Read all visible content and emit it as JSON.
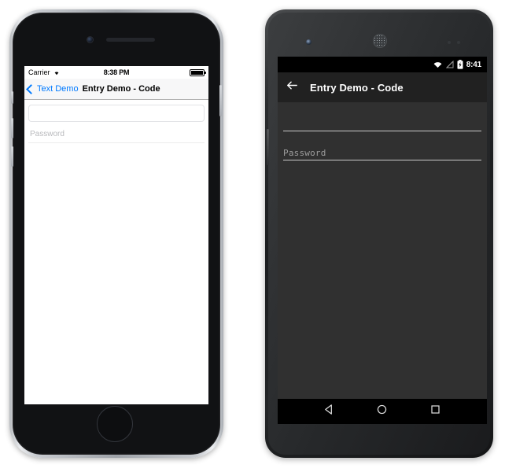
{
  "ios": {
    "device_name": "iphone-device",
    "status_bar": {
      "carrier": "Carrier",
      "wifi_icon": "wifi-icon",
      "time": "8:38 PM",
      "battery_icon": "battery-full-icon"
    },
    "nav_bar": {
      "back_icon": "chevron-left-icon",
      "back_label": "Text Demo",
      "title": "Entry Demo - Code"
    },
    "fields": [
      {
        "name": "entry-field",
        "value": "",
        "placeholder": ""
      },
      {
        "name": "password-field",
        "value": "",
        "placeholder": "Password"
      }
    ],
    "hardware": {
      "camera": "front-camera",
      "speaker": "earpiece-speaker",
      "home_button": "home-button",
      "mute_switch": "mute-switch",
      "volume_up": "volume-up-button",
      "volume_down": "volume-down-button",
      "power": "power-button"
    }
  },
  "android": {
    "device_name": "android-device",
    "status_bar": {
      "wifi_icon": "wifi-icon",
      "signal_icon": "no-signal-icon",
      "battery_icon": "battery-charging-icon",
      "time": "8:41"
    },
    "app_bar": {
      "back_icon": "arrow-left-icon",
      "title": "Entry Demo - Code"
    },
    "fields": [
      {
        "name": "entry-field",
        "value": "",
        "placeholder": ""
      },
      {
        "name": "password-field",
        "value": "",
        "placeholder": "Password"
      }
    ],
    "nav_bar": {
      "back_icon": "nav-back-triangle-icon",
      "home_icon": "nav-home-circle-icon",
      "recents_icon": "nav-recents-square-icon"
    },
    "hardware": {
      "camera": "front-camera",
      "speaker": "earpiece-speaker",
      "sensors": "proximity-sensors",
      "volume": "volume-rocker"
    }
  },
  "colors": {
    "ios_accent": "#007AFF",
    "ios_navbar_bg": "#F7F7F8",
    "android_appbar_bg": "#212121",
    "android_content_bg": "#303030",
    "android_statusbar_bg": "#000000"
  }
}
